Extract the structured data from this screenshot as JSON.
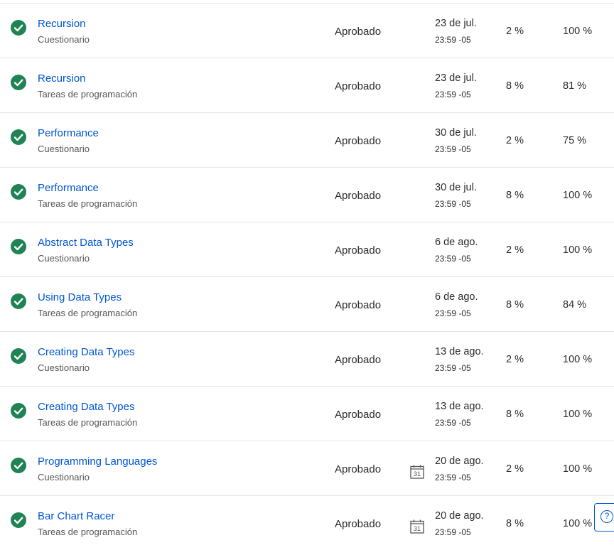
{
  "assignments": [
    {
      "title": "Recursion",
      "kind": "Cuestionario",
      "status": "Aprobado",
      "date": "23 de jul.",
      "time": "23:59 -05",
      "weight": "2 %",
      "grade": "100 %",
      "calendar": false
    },
    {
      "title": "Recursion",
      "kind": "Tareas de programación",
      "status": "Aprobado",
      "date": "23 de jul.",
      "time": "23:59 -05",
      "weight": "8 %",
      "grade": "81 %",
      "calendar": false
    },
    {
      "title": "Performance",
      "kind": "Cuestionario",
      "status": "Aprobado",
      "date": "30 de jul.",
      "time": "23:59 -05",
      "weight": "2 %",
      "grade": "75 %",
      "calendar": false
    },
    {
      "title": "Performance",
      "kind": "Tareas de programación",
      "status": "Aprobado",
      "date": "30 de jul.",
      "time": "23:59 -05",
      "weight": "8 %",
      "grade": "100 %",
      "calendar": false
    },
    {
      "title": "Abstract Data Types",
      "kind": "Cuestionario",
      "status": "Aprobado",
      "date": "6 de ago.",
      "time": "23:59 -05",
      "weight": "2 %",
      "grade": "100 %",
      "calendar": false
    },
    {
      "title": "Using Data Types",
      "kind": "Tareas de programación",
      "status": "Aprobado",
      "date": "6 de ago.",
      "time": "23:59 -05",
      "weight": "8 %",
      "grade": "84 %",
      "calendar": false
    },
    {
      "title": "Creating Data Types",
      "kind": "Cuestionario",
      "status": "Aprobado",
      "date": "13 de ago.",
      "time": "23:59 -05",
      "weight": "2 %",
      "grade": "100 %",
      "calendar": false
    },
    {
      "title": "Creating Data Types",
      "kind": "Tareas de programación",
      "status": "Aprobado",
      "date": "13 de ago.",
      "time": "23:59 -05",
      "weight": "8 %",
      "grade": "100 %",
      "calendar": false
    },
    {
      "title": "Programming Languages",
      "kind": "Cuestionario",
      "status": "Aprobado",
      "date": "20 de ago.",
      "time": "23:59 -05",
      "weight": "2 %",
      "grade": "100 %",
      "calendar": true
    },
    {
      "title": "Bar Chart Racer",
      "kind": "Tareas de programación",
      "status": "Aprobado",
      "date": "20 de ago.",
      "time": "23:59 -05",
      "weight": "8 %",
      "grade": "100 %",
      "calendar": true
    }
  ],
  "calendar_day": "31",
  "help_symbol": "?",
  "colors": {
    "accent": "#0056d2",
    "success": "#1f8354",
    "divider": "#e5e5e5"
  },
  "icons": {
    "status": "check-circle-icon",
    "due": "calendar-icon",
    "help": "help-icon"
  }
}
